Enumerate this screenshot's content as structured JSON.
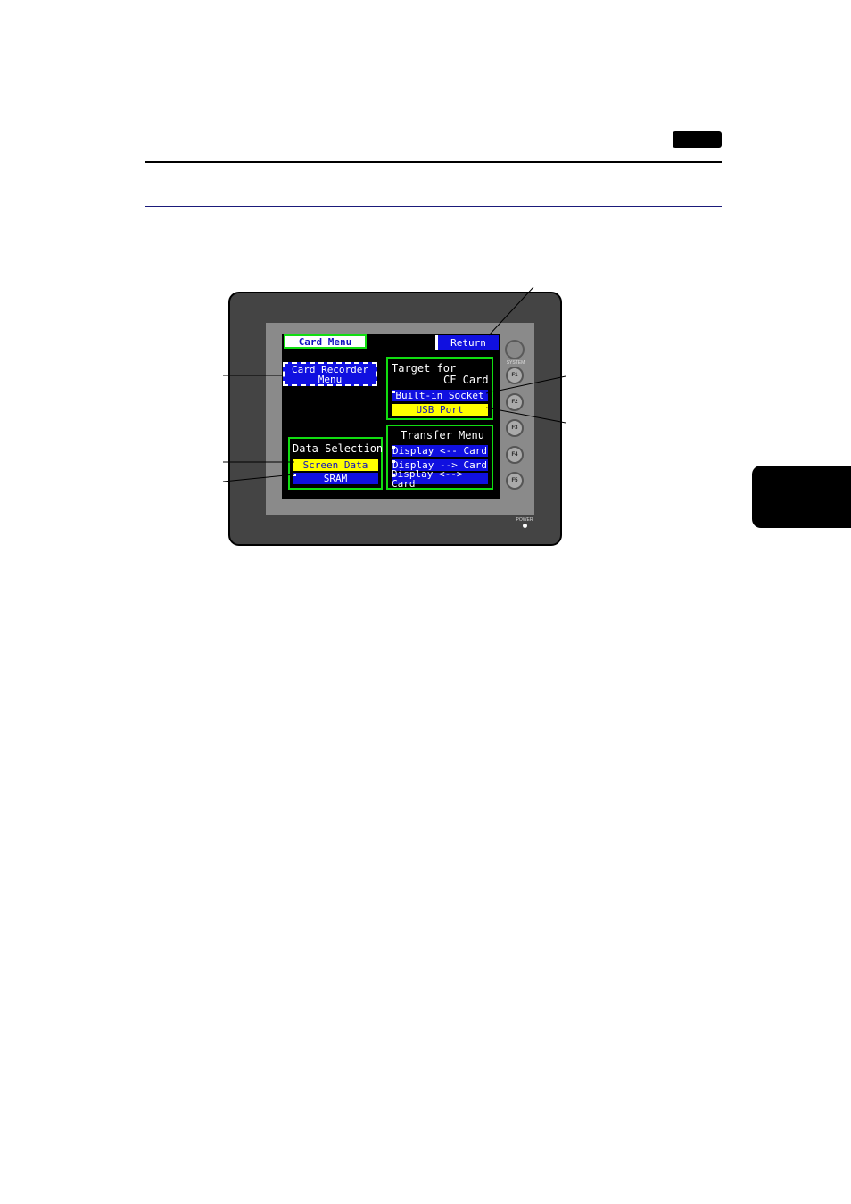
{
  "screen": {
    "title": "Card Menu",
    "return_label": "Return",
    "card_recorder": {
      "line1": "Card Recorder",
      "line2": "Menu"
    },
    "target": {
      "heading_line1": "Target for",
      "heading_line2": "CF Card",
      "options": [
        "Built-in Socket",
        "USB Port"
      ],
      "selected": "USB Port"
    },
    "data_selection": {
      "heading": "Data Selection",
      "options": [
        "Screen Data",
        "SRAM"
      ],
      "selected": "Screen Data"
    },
    "transfer": {
      "heading": "Transfer Menu",
      "options": [
        "Display <-- Card",
        "Display --> Card",
        "Display <--> Card"
      ]
    }
  },
  "device": {
    "system_label": "SYSTEM",
    "function_keys": [
      "F1",
      "F2",
      "F3",
      "F4",
      "F5"
    ],
    "power_label": "POWER"
  },
  "colors": {
    "button_blue": "#1010e0",
    "selected_yellow": "#ffff00",
    "frame_green": "#11dd11",
    "lcd_background": "#000000"
  }
}
